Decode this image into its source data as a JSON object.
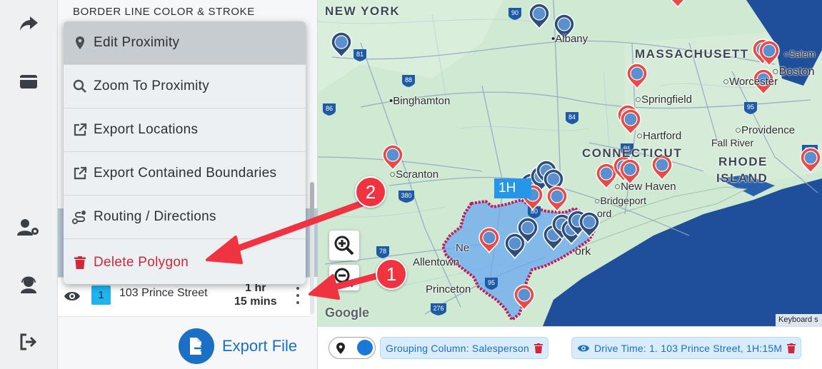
{
  "panel": {
    "heading": "BORDER LINE COLOR & STROKE",
    "route": {
      "index": "1",
      "name": "103 Prince Street",
      "time_line1": "1 hr",
      "time_line2": "15 mins"
    },
    "export_label": "Export File"
  },
  "menu": {
    "items": [
      {
        "label": "Edit Proximity",
        "icon": "map-pin-icon"
      },
      {
        "label": "Zoom To Proximity",
        "icon": "search-icon"
      },
      {
        "label": "Export Locations",
        "icon": "external-link-icon"
      },
      {
        "label": "Export Contained Boundaries",
        "icon": "external-link-icon"
      },
      {
        "label": "Routing / Directions",
        "icon": "route-icon"
      },
      {
        "label": "Delete Polygon",
        "icon": "trash-icon"
      }
    ]
  },
  "map": {
    "cities": [
      "Albany",
      "Binghamton",
      "Scranton",
      "Allentown",
      "Princeton",
      "Springfield",
      "Worcester",
      "Boston",
      "Salem",
      "Hartford",
      "Providence",
      "Fall River",
      "New Haven",
      "Bridgeport",
      "Ne",
      "ord",
      "ork"
    ],
    "states": [
      "NEW YORK",
      "MASSACHUSETT",
      "CONNECTICUT",
      "RHODE",
      "ISLAND"
    ],
    "highways": [
      "90",
      "81",
      "88",
      "86",
      "84",
      "91",
      "95",
      "195",
      "380",
      "80",
      "276",
      "95",
      "78"
    ],
    "drive_label": "1H",
    "google": "Google",
    "keyboard": "Keyboard s"
  },
  "bottombar": {
    "chips": [
      "Grouping Column: Salesperson",
      "Drive Time: 1. 103 Prince Street, 1H:15M"
    ]
  },
  "annotations": [
    "1",
    "2"
  ],
  "colors": {
    "accent": "#1b6fc4",
    "danger": "#d1273a",
    "polygon_fill": "#6aa8ef",
    "polygon_border": "#c2185b",
    "pin_red": "#e94a45",
    "pin_navy": "#2e4d7a"
  }
}
